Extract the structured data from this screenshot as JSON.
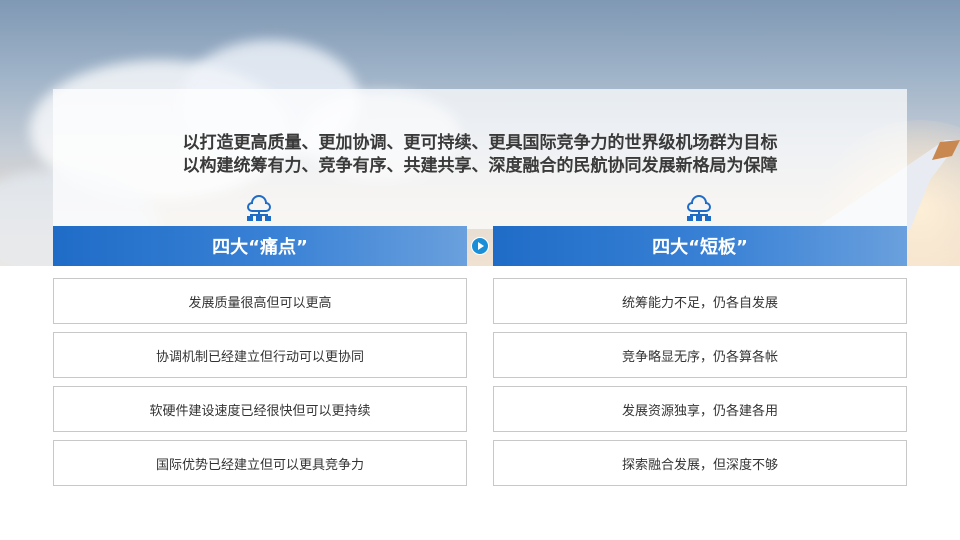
{
  "headline": {
    "line1": "以打造更高质量、更加协调、更可持续、更具国际竞争力的世界级机场群为目标",
    "line2": "以构建统筹有力、竞争有序、共建共享、深度融合的民航协同发展新格局为保障"
  },
  "left": {
    "title": "四大“痛点”",
    "items": [
      "发展质量很高但可以更高",
      "协调机制已经建立但行动可以更协同",
      "软硬件建设速度已经很快但可以更持续",
      "国际优势已经建立但可以更具竞争力"
    ]
  },
  "right": {
    "title": "四大“短板”",
    "items": [
      "统筹能力不足，仍各自发展",
      "竞争略显无序，仍各算各帐",
      "发展资源独享，仍各建各用",
      "探索融合发展，但深度不够"
    ]
  },
  "colors": {
    "accent": "#1f6cc7",
    "play": "#1a8fd8"
  },
  "icons": [
    "network-icon",
    "play-icon"
  ]
}
